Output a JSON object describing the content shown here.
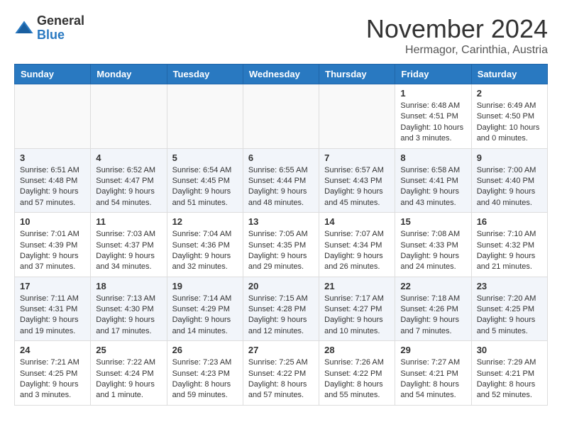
{
  "header": {
    "logo_general": "General",
    "logo_blue": "Blue",
    "month_title": "November 2024",
    "subtitle": "Hermagor, Carinthia, Austria"
  },
  "weekdays": [
    "Sunday",
    "Monday",
    "Tuesday",
    "Wednesday",
    "Thursday",
    "Friday",
    "Saturday"
  ],
  "weeks": [
    [
      {
        "day": "",
        "info": ""
      },
      {
        "day": "",
        "info": ""
      },
      {
        "day": "",
        "info": ""
      },
      {
        "day": "",
        "info": ""
      },
      {
        "day": "",
        "info": ""
      },
      {
        "day": "1",
        "info": "Sunrise: 6:48 AM\nSunset: 4:51 PM\nDaylight: 10 hours\nand 3 minutes."
      },
      {
        "day": "2",
        "info": "Sunrise: 6:49 AM\nSunset: 4:50 PM\nDaylight: 10 hours\nand 0 minutes."
      }
    ],
    [
      {
        "day": "3",
        "info": "Sunrise: 6:51 AM\nSunset: 4:48 PM\nDaylight: 9 hours\nand 57 minutes."
      },
      {
        "day": "4",
        "info": "Sunrise: 6:52 AM\nSunset: 4:47 PM\nDaylight: 9 hours\nand 54 minutes."
      },
      {
        "day": "5",
        "info": "Sunrise: 6:54 AM\nSunset: 4:45 PM\nDaylight: 9 hours\nand 51 minutes."
      },
      {
        "day": "6",
        "info": "Sunrise: 6:55 AM\nSunset: 4:44 PM\nDaylight: 9 hours\nand 48 minutes."
      },
      {
        "day": "7",
        "info": "Sunrise: 6:57 AM\nSunset: 4:43 PM\nDaylight: 9 hours\nand 45 minutes."
      },
      {
        "day": "8",
        "info": "Sunrise: 6:58 AM\nSunset: 4:41 PM\nDaylight: 9 hours\nand 43 minutes."
      },
      {
        "day": "9",
        "info": "Sunrise: 7:00 AM\nSunset: 4:40 PM\nDaylight: 9 hours\nand 40 minutes."
      }
    ],
    [
      {
        "day": "10",
        "info": "Sunrise: 7:01 AM\nSunset: 4:39 PM\nDaylight: 9 hours\nand 37 minutes."
      },
      {
        "day": "11",
        "info": "Sunrise: 7:03 AM\nSunset: 4:37 PM\nDaylight: 9 hours\nand 34 minutes."
      },
      {
        "day": "12",
        "info": "Sunrise: 7:04 AM\nSunset: 4:36 PM\nDaylight: 9 hours\nand 32 minutes."
      },
      {
        "day": "13",
        "info": "Sunrise: 7:05 AM\nSunset: 4:35 PM\nDaylight: 9 hours\nand 29 minutes."
      },
      {
        "day": "14",
        "info": "Sunrise: 7:07 AM\nSunset: 4:34 PM\nDaylight: 9 hours\nand 26 minutes."
      },
      {
        "day": "15",
        "info": "Sunrise: 7:08 AM\nSunset: 4:33 PM\nDaylight: 9 hours\nand 24 minutes."
      },
      {
        "day": "16",
        "info": "Sunrise: 7:10 AM\nSunset: 4:32 PM\nDaylight: 9 hours\nand 21 minutes."
      }
    ],
    [
      {
        "day": "17",
        "info": "Sunrise: 7:11 AM\nSunset: 4:31 PM\nDaylight: 9 hours\nand 19 minutes."
      },
      {
        "day": "18",
        "info": "Sunrise: 7:13 AM\nSunset: 4:30 PM\nDaylight: 9 hours\nand 17 minutes."
      },
      {
        "day": "19",
        "info": "Sunrise: 7:14 AM\nSunset: 4:29 PM\nDaylight: 9 hours\nand 14 minutes."
      },
      {
        "day": "20",
        "info": "Sunrise: 7:15 AM\nSunset: 4:28 PM\nDaylight: 9 hours\nand 12 minutes."
      },
      {
        "day": "21",
        "info": "Sunrise: 7:17 AM\nSunset: 4:27 PM\nDaylight: 9 hours\nand 10 minutes."
      },
      {
        "day": "22",
        "info": "Sunrise: 7:18 AM\nSunset: 4:26 PM\nDaylight: 9 hours\nand 7 minutes."
      },
      {
        "day": "23",
        "info": "Sunrise: 7:20 AM\nSunset: 4:25 PM\nDaylight: 9 hours\nand 5 minutes."
      }
    ],
    [
      {
        "day": "24",
        "info": "Sunrise: 7:21 AM\nSunset: 4:25 PM\nDaylight: 9 hours\nand 3 minutes."
      },
      {
        "day": "25",
        "info": "Sunrise: 7:22 AM\nSunset: 4:24 PM\nDaylight: 9 hours\nand 1 minute."
      },
      {
        "day": "26",
        "info": "Sunrise: 7:23 AM\nSunset: 4:23 PM\nDaylight: 8 hours\nand 59 minutes."
      },
      {
        "day": "27",
        "info": "Sunrise: 7:25 AM\nSunset: 4:22 PM\nDaylight: 8 hours\nand 57 minutes."
      },
      {
        "day": "28",
        "info": "Sunrise: 7:26 AM\nSunset: 4:22 PM\nDaylight: 8 hours\nand 55 minutes."
      },
      {
        "day": "29",
        "info": "Sunrise: 7:27 AM\nSunset: 4:21 PM\nDaylight: 8 hours\nand 54 minutes."
      },
      {
        "day": "30",
        "info": "Sunrise: 7:29 AM\nSunset: 4:21 PM\nDaylight: 8 hours\nand 52 minutes."
      }
    ]
  ]
}
